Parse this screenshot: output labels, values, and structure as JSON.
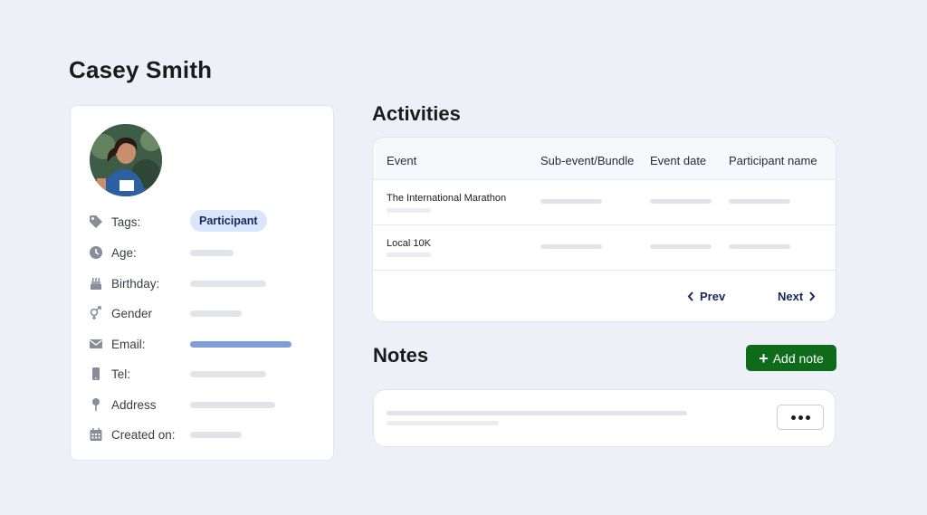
{
  "profile": {
    "name": "Casey Smith",
    "fields": [
      {
        "icon": "tag-icon",
        "label": "Tags:"
      },
      {
        "icon": "clock-icon",
        "label": "Age:"
      },
      {
        "icon": "cake-icon",
        "label": "Birthday:"
      },
      {
        "icon": "gender-icon",
        "label": "Gender"
      },
      {
        "icon": "email-icon",
        "label": "Email:"
      },
      {
        "icon": "phone-icon",
        "label": "Tel:"
      },
      {
        "icon": "location-pin-icon",
        "label": "Address"
      },
      {
        "icon": "calendar-icon",
        "label": "Created on:"
      }
    ],
    "tag": "Participant",
    "colors": {
      "tag_bg": "#d9e6fb",
      "email_bar": "#7f9dd8"
    }
  },
  "activities": {
    "title": "Activities",
    "columns": [
      "Event",
      "Sub-event/Bundle",
      "Event date",
      "Participant name"
    ],
    "rows": [
      {
        "event": "The International Marathon"
      },
      {
        "event": "Local 10K"
      }
    ],
    "prev_label": "Prev",
    "next_label": "Next"
  },
  "notes": {
    "title": "Notes",
    "add_label": "Add note",
    "more_label": "more-options"
  },
  "colors": {
    "background": "#eef0f8",
    "primary_button": "#0d6b19",
    "link": "#16295a"
  }
}
